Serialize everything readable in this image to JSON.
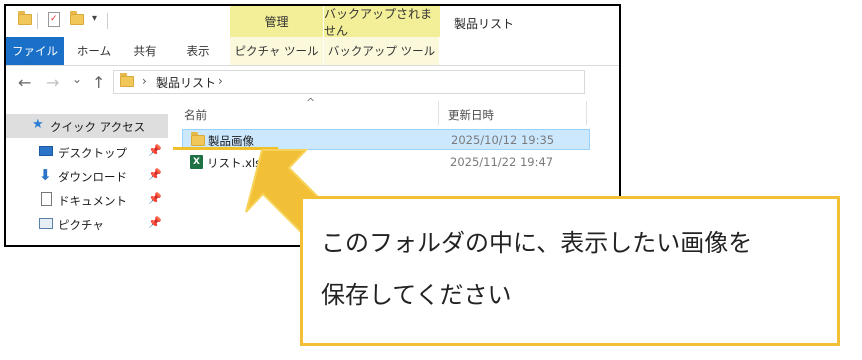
{
  "window": {
    "title": "製品リスト",
    "contextual_tabs": {
      "manage": "管理",
      "backup": "バックアップされません"
    }
  },
  "ribbon": {
    "tabs": [
      "ファイル",
      "ホーム",
      "共有",
      "表示",
      "ピクチャ ツール",
      "バックアップ ツール"
    ]
  },
  "address": {
    "back": "←",
    "forward": "→",
    "recent": "⌄",
    "up": "↑",
    "path_sep": "›",
    "path": "製品リスト",
    "path_end": "›"
  },
  "nav_pane": {
    "items": [
      {
        "label": "クイック アクセス",
        "icon": "star-icon"
      },
      {
        "label": "デスクトップ",
        "icon": "desktop-icon",
        "pin": "📌"
      },
      {
        "label": "ダウンロード",
        "icon": "download-icon",
        "pin": "📌"
      },
      {
        "label": "ドキュメント",
        "icon": "document-icon",
        "pin": "📌"
      },
      {
        "label": "ピクチャ",
        "icon": "pictures-icon",
        "pin": "📌"
      }
    ]
  },
  "file_list": {
    "columns": {
      "name": "名前",
      "modified": "更新日時"
    },
    "sort_indicator": "^",
    "rows": [
      {
        "name": "製品画像",
        "modified": "2025/10/12 19:35",
        "icon": "folder-icon",
        "selected": true
      },
      {
        "name": "リスト.xlsm",
        "modified": "2025/11/22 19:47",
        "icon": "excel-icon",
        "selected": false
      }
    ]
  },
  "excel_letter": "X",
  "annotation": {
    "lines": [
      "このフォルダの中に、表示したい画像を",
      "保存してください"
    ],
    "accent_color": "#f2c037"
  },
  "colors": {
    "file_tab": "#1a6fc7",
    "contextual": "#f3ee98",
    "selection": "#cce8ff"
  }
}
